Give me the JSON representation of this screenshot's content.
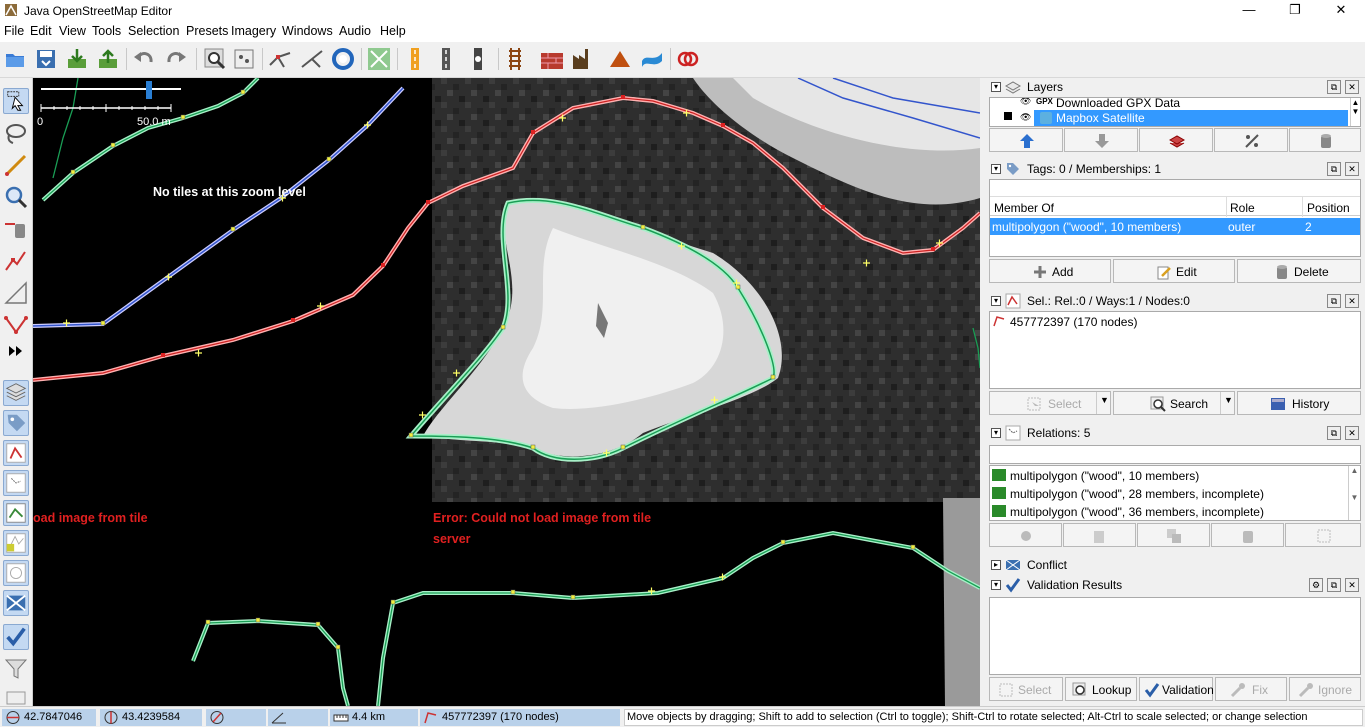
{
  "window": {
    "title": "Java OpenStreetMap Editor",
    "minimize": "—",
    "maximize": "❐",
    "close": "✕"
  },
  "menu": [
    "File",
    "Edit",
    "View",
    "Tools",
    "Selection",
    "Presets",
    "Imagery",
    "Windows",
    "Audio",
    "Help"
  ],
  "map": {
    "scale_zero": "0",
    "scale_label": "50.0 m",
    "no_tiles_msg": "No tiles at this zoom level",
    "error_left": "oad image from tile",
    "error_main_line1": "Error: Could not load image from tile",
    "error_main_line2": "server"
  },
  "layers": {
    "header": "Layers",
    "items": [
      {
        "label": "Downloaded GPX Data",
        "prefix": "GPX"
      },
      {
        "label": "Mapbox Satellite",
        "selected": true
      }
    ]
  },
  "tags": {
    "header": "Tags: 0 / Memberships: 1",
    "columns": [
      "Member Of",
      "Role",
      "Position"
    ],
    "rows": [
      {
        "member_of": "multipolygon (\"wood\", 10 members)",
        "role": "outer",
        "position": "2"
      }
    ],
    "buttons": [
      "Add",
      "Edit",
      "Delete"
    ]
  },
  "selection": {
    "header": "Sel.: Rel.:0 / Ways:1 / Nodes:0",
    "items": [
      "457772397 (170 nodes)"
    ],
    "buttons": [
      "Select",
      "Search",
      "History"
    ]
  },
  "relations": {
    "header": "Relations: 5",
    "items": [
      "multipolygon (\"wood\", 10 members)",
      "multipolygon (\"wood\", 28 members, incomplete)",
      "multipolygon (\"wood\", 36 members, incomplete)"
    ]
  },
  "conflict": {
    "header": "Conflict"
  },
  "validation": {
    "header": "Validation Results",
    "buttons": [
      "Select",
      "Lookup",
      "Validation",
      "Fix",
      "Ignore"
    ]
  },
  "status": {
    "lat": "42.7847046",
    "lon": "43.4239584",
    "distance": "4.4 km",
    "selected_way": "457772397 (170 nodes)",
    "help": "Move objects by dragging; Shift to add to selection (Ctrl to toggle); Shift-Ctrl to rotate selected; Alt-Ctrl to scale selected; or change selection"
  },
  "colors": {
    "accent": "#3399ff",
    "way_green": "#1a9e55",
    "way_blue": "#3355cc",
    "way_red": "#cc2222",
    "error_red": "#e02020"
  }
}
